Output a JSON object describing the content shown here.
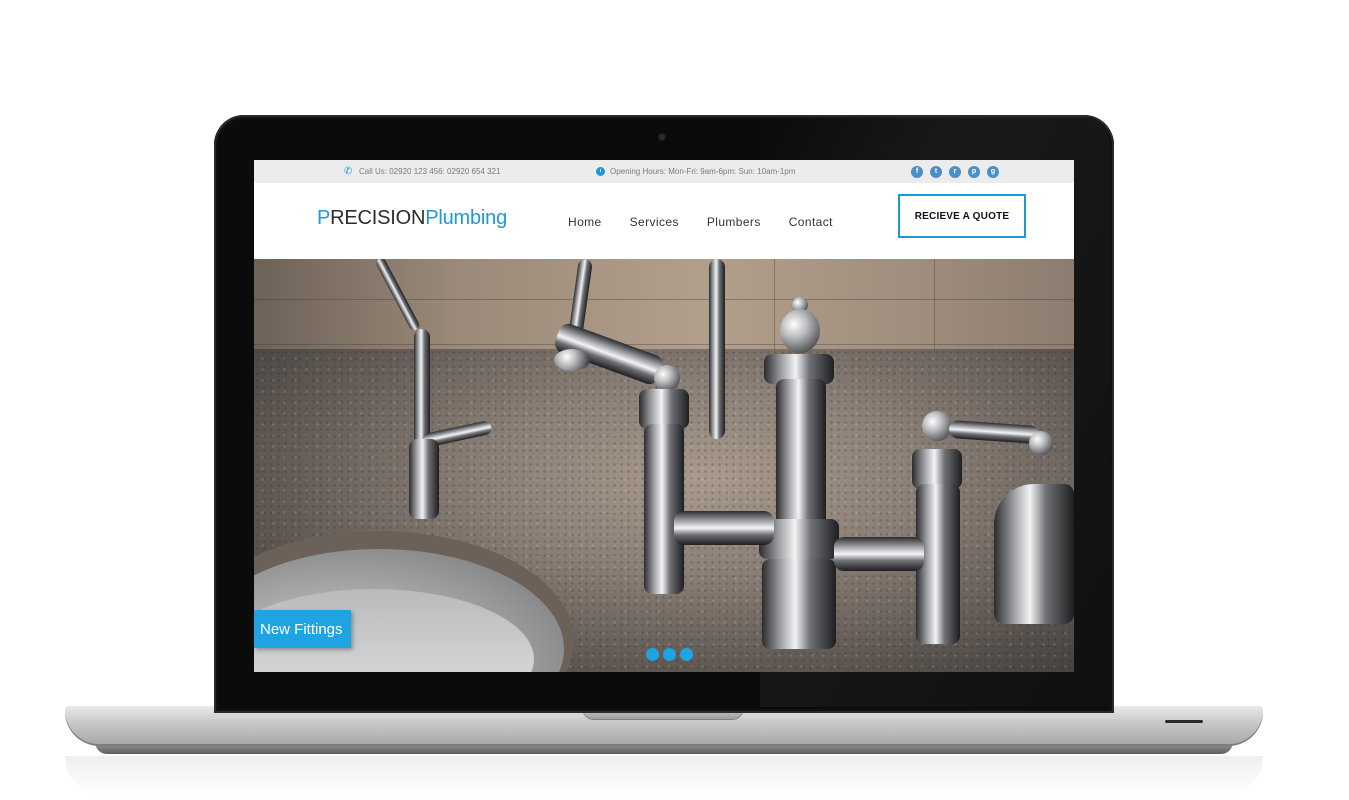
{
  "topbar": {
    "call_text": "Call Us: 02920 123 456: 02920 654 321",
    "hours_text": "Opening Hours: Mon-Fri: 9am-6pm: Sun: 10am-1pm",
    "socials": [
      {
        "icon": "facebook-icon",
        "glyph": "f"
      },
      {
        "icon": "twitter-icon",
        "glyph": "t"
      },
      {
        "icon": "rss-icon",
        "glyph": "r"
      },
      {
        "icon": "pinterest-icon",
        "glyph": "p"
      },
      {
        "icon": "google-plus-icon",
        "glyph": "g"
      }
    ]
  },
  "logo": {
    "part1": "P",
    "part2": "RECISION",
    "part3": "Plumbing"
  },
  "nav": {
    "items": [
      "Home",
      "Services",
      "Plumbers",
      "Contact"
    ]
  },
  "quote_button": "RECIEVE A QUOTE",
  "hero": {
    "caption": "New Fittings",
    "slides_count": 3,
    "active_slide": 1
  },
  "colors": {
    "accent": "#1b9ad7",
    "caption_bg": "#1ea3e3",
    "topbar_bg": "#ececec"
  }
}
